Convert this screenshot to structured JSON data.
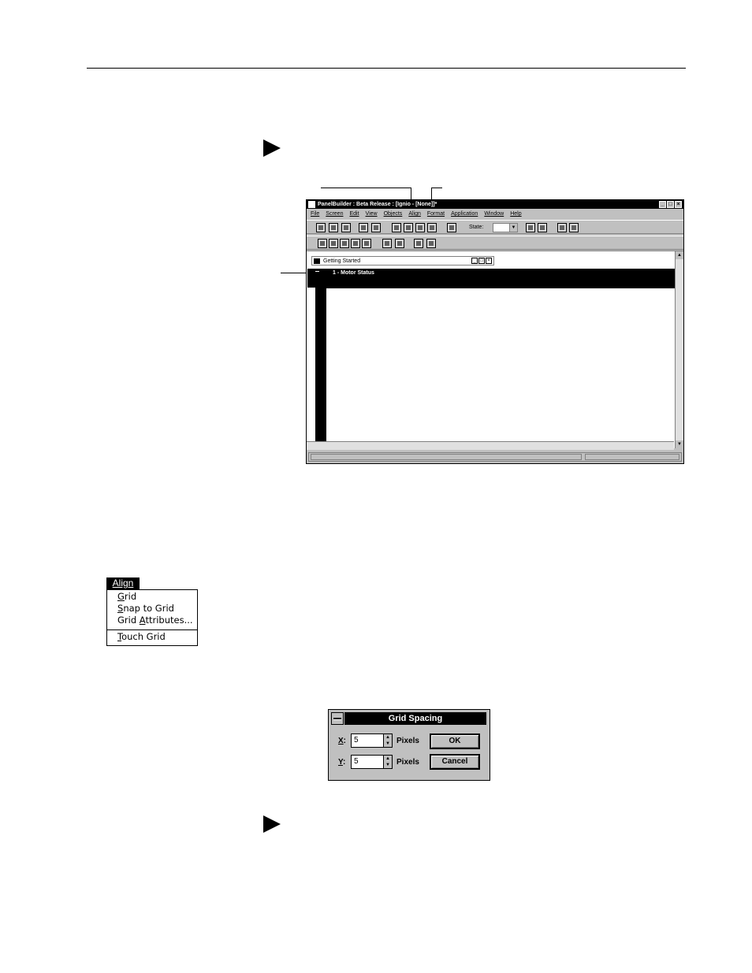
{
  "app_window": {
    "title": "PanelBuilder : Beta Release : [Ignio - [None]]*",
    "controls": [
      "_",
      "□",
      "×"
    ],
    "menu": [
      "File",
      "Screen",
      "Edit",
      "View",
      "Objects",
      "Align",
      "Format",
      "Application",
      "Window",
      "Help"
    ],
    "toolbar": {
      "state_label": "State:"
    },
    "child_window": {
      "title": "Getting Started",
      "controls": [
        "_",
        "□",
        "×"
      ]
    },
    "screen": {
      "title": "1 - Motor Status"
    }
  },
  "align_menu": {
    "header": "Align",
    "items": [
      {
        "pre": "",
        "u": "G",
        "post": "rid"
      },
      {
        "pre": "",
        "u": "S",
        "post": "nap to Grid"
      },
      {
        "pre": "Grid ",
        "u": "A",
        "post": "ttributes..."
      },
      {
        "pre": "",
        "u": "T",
        "post": "ouch Grid"
      }
    ]
  },
  "grid_dialog": {
    "title": "Grid Spacing",
    "x_label": "X",
    "y_label": "Y",
    "x_value": "5",
    "y_value": "5",
    "unit": "Pixels",
    "ok_label": "OK",
    "cancel_label": "Cancel"
  }
}
